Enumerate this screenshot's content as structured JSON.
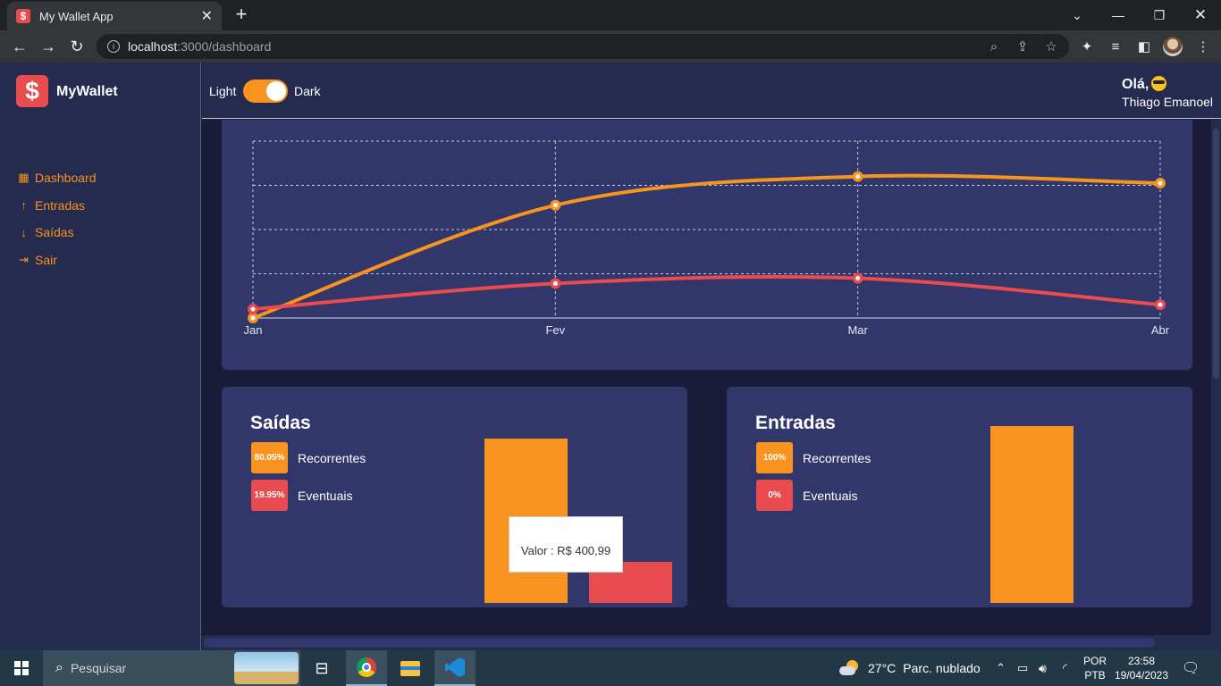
{
  "browser": {
    "tab_title": "My Wallet App",
    "tab_favicon": "$",
    "url_host": "localhost",
    "url_path": ":3000/dashboard"
  },
  "app": {
    "logo_symbol": "$",
    "name": "MyWallet",
    "menu": [
      {
        "label": "Dashboard",
        "icon": "dashboard-icon"
      },
      {
        "label": "Entradas",
        "icon": "arrow-up-icon"
      },
      {
        "label": "Saídas",
        "icon": "arrow-down-icon"
      },
      {
        "label": "Sair",
        "icon": "exit-icon"
      }
    ],
    "toggle": {
      "left_label": "Light",
      "right_label": "Dark",
      "state": "dark"
    },
    "greeting": {
      "hello": "Olá,",
      "name": "Thiago Emanoel"
    },
    "colors": {
      "accent": "#f7931e",
      "danger": "#e84c4f",
      "card": "#31376a",
      "bg": "#1b1c3a"
    }
  },
  "chart_data": [
    {
      "type": "line",
      "x": [
        "Jan",
        "Fev",
        "Mar",
        "Abr"
      ],
      "series": [
        {
          "color": "#f7931e",
          "values": [
            0,
            2.55,
            3.2,
            3.05
          ]
        },
        {
          "color": "#e84c4f",
          "values": [
            0.2,
            0.78,
            0.9,
            0.3
          ]
        }
      ],
      "ylim": [
        0,
        4
      ],
      "grid": true
    },
    {
      "type": "bar",
      "title": "Saídas",
      "legend": [
        {
          "badge": "80.05%",
          "label": "Recorrentes",
          "color": "#f7931e"
        },
        {
          "badge": "19.95%",
          "label": "Eventuais",
          "color": "#e84c4f"
        }
      ],
      "values": [
        80.05,
        19.95
      ],
      "tooltip": "Valor : R$ 400,99"
    },
    {
      "type": "bar",
      "title": "Entradas",
      "legend": [
        {
          "badge": "100%",
          "label": "Recorrentes",
          "color": "#f7931e"
        },
        {
          "badge": "0%",
          "label": "Eventuais",
          "color": "#e84c4f"
        }
      ],
      "values": [
        100,
        0
      ]
    }
  ],
  "taskbar": {
    "search_placeholder": "Pesquisar",
    "weather": "27°C",
    "weather_desc": "Parc. nublado",
    "lang_top": "POR",
    "lang_bottom": "PTB",
    "time": "23:58",
    "date": "19/04/2023"
  }
}
